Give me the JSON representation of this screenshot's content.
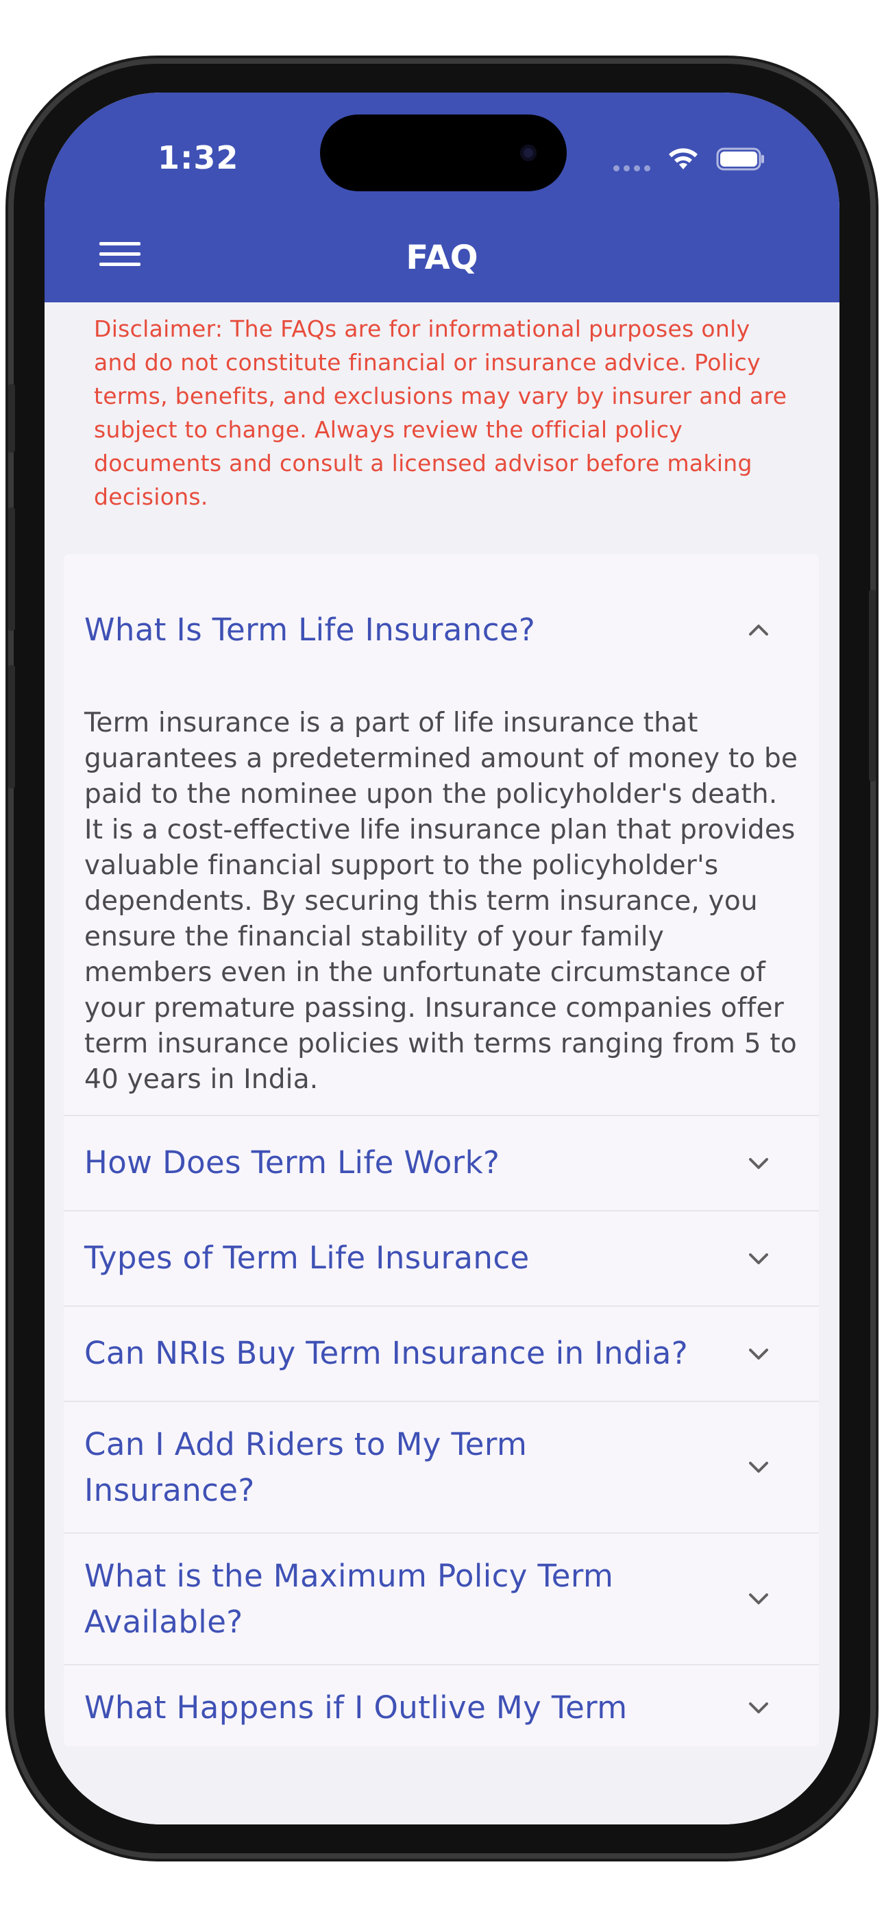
{
  "status_bar": {
    "time": "1:32"
  },
  "appbar": {
    "title": "FAQ",
    "menu_icon": "hamburger-menu-icon",
    "color": "#3f51b5"
  },
  "disclaimer": "Disclaimer: The FAQs are for informational purposes only and do not constitute financial or insurance advice. Policy terms, benefits, and exclusions may vary by insurer and are subject to change. Always review the official policy documents and consult a licensed advisor before making decisions.",
  "faqs": [
    {
      "question": "What Is Term Life Insurance?",
      "expanded": true,
      "answer": "Term insurance is a part of life insurance that guarantees a predetermined amount of money to be paid to the nominee upon the policyholder's death. It is a cost-effective life insurance plan that provides valuable financial support to the policyholder's dependents. By securing this term insurance, you ensure the financial stability of your family members even in the unfortunate circumstance of your premature passing. Insurance companies offer term insurance policies with terms ranging from 5 to 40 years in India."
    },
    {
      "question": "How Does Term Life Work?",
      "expanded": false
    },
    {
      "question": "Types of Term Life Insurance",
      "expanded": false
    },
    {
      "question": "Can NRIs Buy Term Insurance in India?",
      "expanded": false
    },
    {
      "question": "Can I Add Riders to My Term Insurance?",
      "expanded": false
    },
    {
      "question": "What is the Maximum Policy Term Available?",
      "expanded": false
    },
    {
      "question": "What Happens if I Outlive My Term",
      "expanded": false
    }
  ],
  "colors": {
    "accent": "#3f51b5",
    "disclaimer_text": "#e74c3c",
    "answer_text": "#4a4a4f",
    "background": "#f2f1f6",
    "card": "#f8f6fb"
  }
}
